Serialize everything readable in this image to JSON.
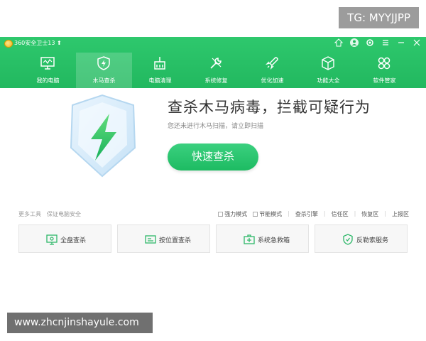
{
  "overlay": {
    "tg_badge": "TG: MYYJJPP",
    "site_badge": "www.zhcnjinshayule.com"
  },
  "app": {
    "title": "360安全卫士13 ⬆",
    "window_controls": [
      "skin-icon",
      "user-icon",
      "settings-icon",
      "menu-icon",
      "minimize-icon",
      "close-icon"
    ]
  },
  "nav": {
    "tabs": [
      {
        "label": "我的电脑",
        "icon": "monitor-icon"
      },
      {
        "label": "木马查杀",
        "icon": "shield-bolt-icon",
        "active": true
      },
      {
        "label": "电脑清理",
        "icon": "broom-icon"
      },
      {
        "label": "系统修复",
        "icon": "wrench-icon"
      },
      {
        "label": "优化加速",
        "icon": "rocket-icon"
      },
      {
        "label": "功能大全",
        "icon": "cube-icon"
      },
      {
        "label": "软件管家",
        "icon": "apps-icon"
      }
    ]
  },
  "hero": {
    "title": "查杀木马病毒，拦截可疑行为",
    "subtitle": "您还未进行木马扫描，请立即扫描",
    "scan_button": "快速查杀"
  },
  "tools": {
    "left": [
      "更多工具",
      "保证电脑安全"
    ],
    "right": {
      "checkboxes": [
        "强力模式",
        "节能模式"
      ],
      "links": [
        "查杀引擎",
        "信任区",
        "恢复区",
        "上报区"
      ]
    }
  },
  "modes": [
    {
      "label": "全盘查杀",
      "icon": "full-scan-icon"
    },
    {
      "label": "按位置查杀",
      "icon": "location-scan-icon"
    },
    {
      "label": "系统急救箱",
      "icon": "first-aid-icon"
    },
    {
      "label": "反勒索服务",
      "icon": "anti-ransom-icon"
    }
  ],
  "colors": {
    "brand_green": "#22b85f",
    "button_green": "#1dbb62",
    "text_dark": "#333333"
  }
}
